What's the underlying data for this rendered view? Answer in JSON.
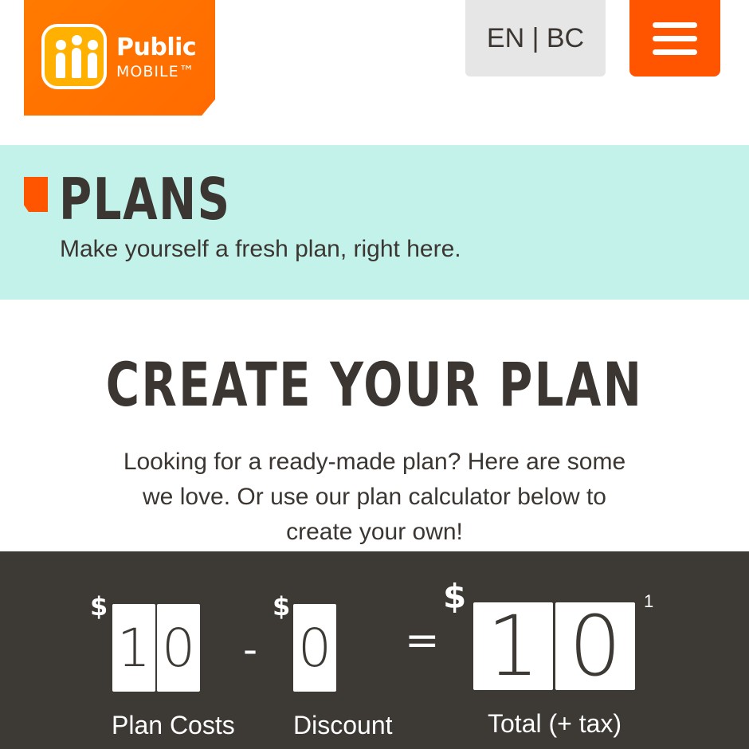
{
  "header": {
    "logo": {
      "line1": "Public",
      "line2": "MOBILE™"
    },
    "language_label": "EN | BC",
    "menu_icon": "hamburger-menu-icon",
    "brand_color": "#ff5500"
  },
  "banner": {
    "title": "PLANS",
    "subtitle": "Make yourself a fresh plan, right here.",
    "background": "#c3f2ea"
  },
  "create": {
    "title": "CREATE YOUR PLAN",
    "description": "Looking for a ready-made plan? Here are some we love. Or use our plan calculator below to create your own!"
  },
  "calculator": {
    "currency_symbol": "$",
    "plan_cost": {
      "digits": [
        "1",
        "0"
      ],
      "label": "Plan Costs"
    },
    "minus_symbol": "-",
    "discount": {
      "digits": [
        "0"
      ],
      "label": "Discount"
    },
    "equals_symbol": "=",
    "total": {
      "digits": [
        "1",
        "0"
      ],
      "label": "Total (+ tax)",
      "footnote": "1"
    }
  }
}
